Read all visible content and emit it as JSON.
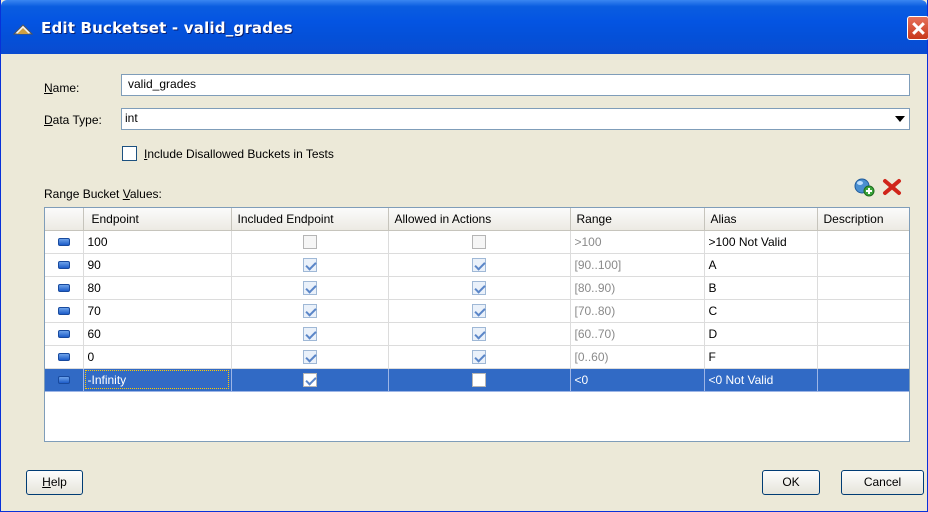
{
  "window": {
    "title": "Edit Bucketset - valid_grades"
  },
  "form": {
    "name_label_u": "N",
    "name_label_rest": "ame:",
    "name_value": "valid_grades",
    "datatype_label_u": "D",
    "datatype_label_rest": "ata Type:",
    "datatype_value": "int",
    "include_u": "I",
    "include_rest": "nclude Disallowed Buckets in Tests",
    "include_checked": false,
    "range_label_pre": "Range Bucket ",
    "range_label_u": "V",
    "range_label_rest": "alues:"
  },
  "toolbar": {
    "add_icon": "add-bucket-icon",
    "delete_icon": "delete-bucket-icon"
  },
  "table": {
    "columns": [
      "Endpoint",
      "Included Endpoint",
      "Allowed in Actions",
      "Range",
      "Alias",
      "Description"
    ],
    "rows": [
      {
        "endpoint": "100",
        "included": false,
        "allowed": false,
        "range": ">100",
        "alias": ">100 Not Valid",
        "description": ""
      },
      {
        "endpoint": "90",
        "included": true,
        "allowed": true,
        "range": "[90..100]",
        "alias": "A",
        "description": ""
      },
      {
        "endpoint": "80",
        "included": true,
        "allowed": true,
        "range": "[80..90)",
        "alias": "B",
        "description": ""
      },
      {
        "endpoint": "70",
        "included": true,
        "allowed": true,
        "range": "[70..80)",
        "alias": "C",
        "description": ""
      },
      {
        "endpoint": "60",
        "included": true,
        "allowed": true,
        "range": "[60..70)",
        "alias": "D",
        "description": ""
      },
      {
        "endpoint": "0",
        "included": true,
        "allowed": true,
        "range": "[0..60)",
        "alias": "F",
        "description": ""
      },
      {
        "endpoint": "-Infinity",
        "included": true,
        "allowed": false,
        "range": "<0",
        "alias": "<0 Not Valid",
        "description": "",
        "selected": true
      }
    ]
  },
  "buttons": {
    "help_u": "H",
    "help_rest": "elp",
    "ok": "OK",
    "cancel": "Cancel"
  },
  "colors": {
    "selection": "#316ac5",
    "titlebar": "#0454e2"
  }
}
